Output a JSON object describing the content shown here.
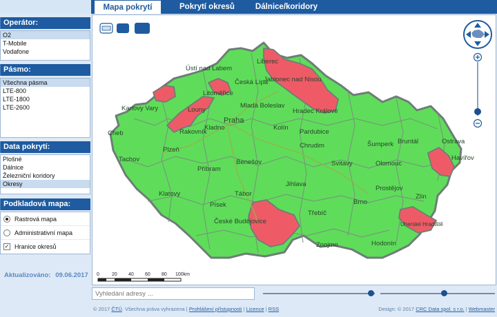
{
  "tabs": [
    {
      "label": "Mapa pokrytí",
      "active": true
    },
    {
      "label": "Pokrytí okresů",
      "active": false
    },
    {
      "label": "Dálnice/koridory",
      "active": false
    }
  ],
  "operator": {
    "title": "Operátor:",
    "items": [
      "O2",
      "T-Mobile",
      "Vodafone"
    ],
    "selected": "O2"
  },
  "band": {
    "title": "Pásmo:",
    "items": [
      "Všechna pásma",
      "LTE-800",
      "LTE-1800",
      "LTE-2600"
    ],
    "selected": "Všechna pásma"
  },
  "coverage_data": {
    "title": "Data pokrytí:",
    "items": [
      "Plošné",
      "Dálnice",
      "Železniční koridory",
      "Okresy"
    ],
    "selected": "Okresy"
  },
  "base_map": {
    "title": "Podkladová mapa:",
    "options": [
      {
        "label": "Rastrová mapa",
        "type": "radio",
        "checked": true
      },
      {
        "label": "Administrativní mapa",
        "type": "radio",
        "checked": false
      },
      {
        "label": "Hranice okresů",
        "type": "checkbox",
        "checked": true
      }
    ]
  },
  "updated": {
    "label": "Aktualizováno:",
    "date": "09.06.2017"
  },
  "map": {
    "colors": {
      "covered": "#5fdd5a",
      "not_covered": "#ee5b67",
      "border": "#6d7d76"
    },
    "scale": {
      "ticks": [
        "0",
        "20",
        "40",
        "60",
        "80",
        "100km"
      ]
    },
    "cities": [
      "Ústí nad Labem",
      "Liberec",
      "Jablonec nad Nisou",
      "Česká Lípa",
      "Litoměřice",
      "Mladá Boleslav",
      "Hradec Králové",
      "Karlovy Vary",
      "Louny",
      "Praha",
      "Cheb",
      "Rakovník",
      "Kladno",
      "Kolín",
      "Pardubice",
      "Chrudim",
      "Svitavy",
      "Šumperk",
      "Bruntál",
      "Ostrava",
      "Havířov",
      "Olomouc",
      "Prostějov",
      "Zlín",
      "Tachov",
      "Plzeň",
      "Příbram",
      "Benešov",
      "Jihlava",
      "Brno",
      "Třebíč",
      "Klatovy",
      "Písek",
      "Tábor",
      "České Budějovice",
      "Znojmo",
      "Hodonín",
      "Uherské Hradiště"
    ]
  },
  "search": {
    "placeholder": "Vyhledání adresy ..."
  },
  "footer": {
    "copyright": "© 2017",
    "ctu": "ČTÚ",
    "rights": ". Všechna práva vyhrazena",
    "links": [
      "Prohlášení přístupnosti",
      "Licence",
      "RSS"
    ],
    "design_label": "Design: © 2017",
    "design_company": "CRC Data spol. s r.o.",
    "webmaster": "Webmaster"
  }
}
